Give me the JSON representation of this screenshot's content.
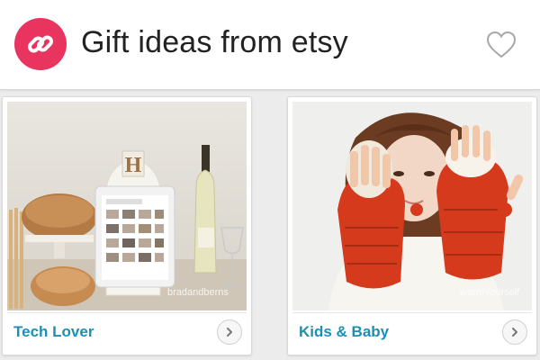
{
  "header": {
    "title": "Gift ideas from etsy",
    "logo_icon": "link-icon",
    "favorite_icon": "heart-icon",
    "brand_color": "#e8345f"
  },
  "cards": [
    {
      "label": "Tech Lover",
      "image_description_icon": "tablet-photo",
      "watermark": "bradandberns",
      "arrow_icon": "chevron-right-icon"
    },
    {
      "label": "Kids & Baby",
      "image_description_icon": "mittens-photo",
      "watermark": "warmYourself",
      "arrow_icon": "chevron-right-icon"
    }
  ],
  "accent_color": "#1b8fb5"
}
